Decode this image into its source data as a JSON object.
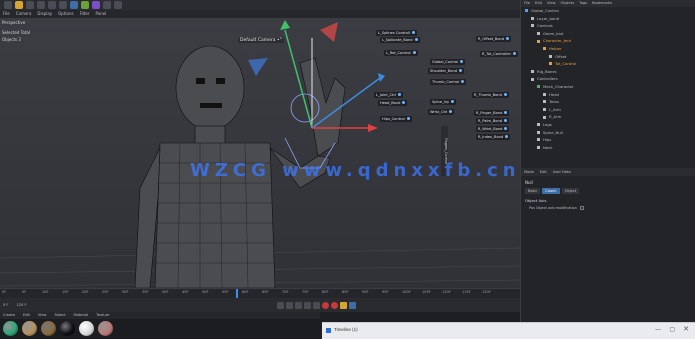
{
  "menu": [
    "File",
    "Camera",
    "Display",
    "Options",
    "Filter",
    "Panel"
  ],
  "viewport": {
    "label": "Perspective",
    "stats": [
      "Selected Total",
      "Objects 3"
    ],
    "camera": "Default Camera •°",
    "watermark": "WZCG  www.qdnxxfb.cn",
    "controls": [
      "L_Splines Controll",
      "L_SpliIonte_Bond",
      "L_Rot_Control",
      "R_Offset_Bond",
      "R_Tot_Controller",
      "Global_Control",
      "Shoulder_Bond",
      "Thumb_Control",
      "L_Joint_Ctrl",
      "R_Thumb_Bond",
      "R_Finger_Bond",
      "R_Palm_Bond",
      "R_Wrist_Bond",
      "R_Index_Bond",
      "Head_Bond",
      "Spine_Up",
      "Wrist_Ctrl",
      "Hips_Control"
    ],
    "vertical_label": "Fingers_Control"
  },
  "timeline": {
    "ticks": [
      "0F",
      "5F",
      "10F",
      "15F",
      "20F",
      "25F",
      "30F",
      "35F",
      "40F",
      "45F",
      "50F",
      "55F",
      "60F",
      "65F",
      "70F",
      "75F",
      "80F",
      "85F",
      "90F",
      "95F",
      "100F",
      "105F",
      "110F",
      "115F",
      "120F"
    ],
    "fps": "0 F",
    "end": "120 F"
  },
  "materials": {
    "menu": [
      "Create",
      "Edit",
      "View",
      "Select",
      "Material",
      "Texture"
    ],
    "colors": [
      "#2ca57a",
      "#b7925f",
      "#8a6a3c",
      "#101014",
      "#d9d9dc",
      "#b97a75"
    ]
  },
  "objects": {
    "menu": [
      "File",
      "Edit",
      "View",
      "Objects",
      "Tags",
      "Bookmarks"
    ],
    "rows": [
      "Global_Control",
      "Layer_bond",
      "Controls",
      "Geom_bnd",
      "Character_bnd",
      "Helper",
      "Offset",
      "Tot_Control",
      "Rig_Bones",
      "Controllers",
      "Mesh_Character",
      "Head",
      "Torso",
      "L_Arm",
      "R_Arm",
      "Legs",
      "Spine_Null",
      "Hips",
      "Neck",
      "L_Joint"
    ]
  },
  "attributes": {
    "menu": [
      "Mode",
      "Edit",
      "User Data"
    ],
    "object": "Null",
    "tabs": [
      "Basic",
      "Coord.",
      "Object"
    ],
    "section": "Object Axis",
    "checkbox_label": "Pos Object axis modification"
  },
  "taskbar": {
    "title": "Timeline (1)"
  }
}
